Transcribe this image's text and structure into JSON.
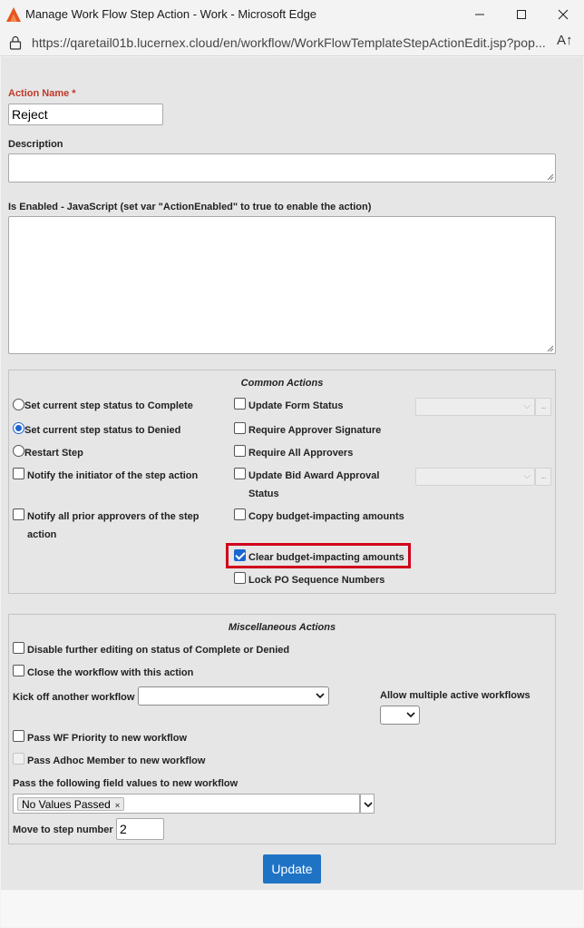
{
  "window": {
    "title": "Manage Work Flow Step Action - Work - Microsoft Edge",
    "url": "https://qaretail01b.lucernex.cloud/en/workflow/WorkFlowTemplateStepActionEdit.jsp?pop...",
    "reader_glyph": "A↑"
  },
  "form": {
    "action_name_label": "Action Name *",
    "action_name_value": "Reject",
    "description_label": "Description",
    "description_value": "",
    "is_enabled_label": "Is Enabled - JavaScript (set var \"ActionEnabled\" to true to enable the action)",
    "is_enabled_value": ""
  },
  "common_actions": {
    "title": "Common Actions",
    "radios": [
      {
        "label": "Set current step status to Complete",
        "checked": false
      },
      {
        "label": "Set current step status to Denied",
        "checked": true
      },
      {
        "label": "Restart Step",
        "checked": false
      }
    ],
    "left_checks": [
      {
        "label_1": "Notify the initiator of the step action",
        "checked": false
      },
      {
        "label_1": "Notify all prior approvers of the step",
        "label_2": "action",
        "checked": false
      }
    ],
    "right_checks": [
      {
        "label_1": "Update Form Status",
        "checked": false
      },
      {
        "label_1": "Require Approver Signature",
        "checked": false
      },
      {
        "label_1": "Require All Approvers",
        "checked": false
      },
      {
        "label_1": "Update Bid Award Approval",
        "label_2": "Status",
        "checked": false
      },
      {
        "label_1": "Copy budget-impacting amounts",
        "checked": false
      },
      {
        "label_1": "Clear budget-impacting amounts",
        "checked": true
      },
      {
        "label_1": "Lock PO Sequence Numbers",
        "checked": false
      }
    ],
    "ellipsis": "..."
  },
  "misc_actions": {
    "title": "Miscellaneous Actions",
    "disable_editing_label": "Disable further editing on status of Complete or Denied",
    "close_workflow_label": "Close the workflow with this action",
    "kickoff_label": "Kick off another workflow",
    "kickoff_value": "",
    "allow_multiple_label": "Allow multiple active workflows",
    "allow_multiple_value": "",
    "pass_priority_label": "Pass WF Priority to new workflow",
    "pass_adhoc_label": "Pass Adhoc Member to new workflow",
    "pass_fields_label": "Pass the following field values to new workflow",
    "pass_fields_chip": "No Values Passed",
    "chip_remove": "×",
    "move_step_label": "Move to step number",
    "move_step_value": "2"
  },
  "buttons": {
    "update": "Update"
  },
  "colors": {
    "primary": "#1f73c5",
    "required": "#c0392b",
    "highlight": "#d0021b",
    "checkbox_checked": "#1a66d1"
  }
}
